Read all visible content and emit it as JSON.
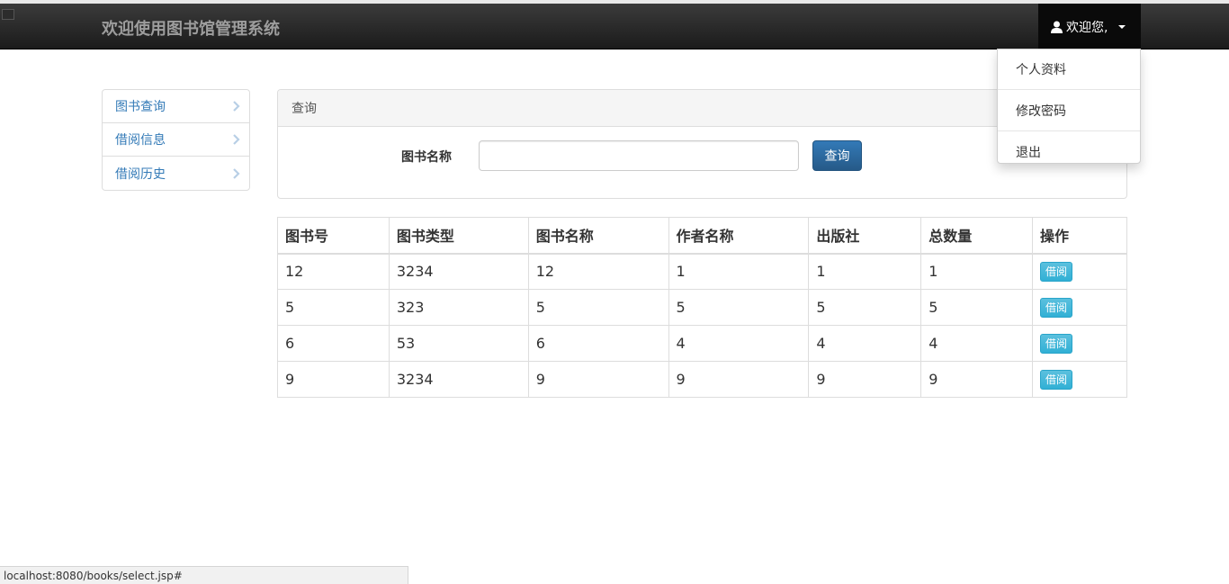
{
  "navbar": {
    "brand": "欢迎使用图书馆管理系统",
    "user_label": "欢迎您,",
    "icons": {
      "user": "user-icon",
      "caret": "caret-down-icon"
    }
  },
  "dropdown": {
    "items": [
      "个人资料",
      "修改密码",
      "退出"
    ]
  },
  "sidebar": {
    "items": [
      {
        "label": "图书查询",
        "icon": "chevron-right-icon"
      },
      {
        "label": "借阅信息",
        "icon": "chevron-right-icon"
      },
      {
        "label": "借阅历史",
        "icon": "chevron-right-icon"
      }
    ]
  },
  "query_panel": {
    "heading": "查询",
    "field_label": "图书名称",
    "input_value": "",
    "button_label": "查询"
  },
  "table": {
    "headers": [
      "图书号",
      "图书类型",
      "图书名称",
      "作者名称",
      "出版社",
      "总数量",
      "操作"
    ],
    "rows": [
      {
        "id": "12",
        "type": "3234",
        "name": "12",
        "author": "1",
        "publisher": "1",
        "total": "1",
        "action": "借阅"
      },
      {
        "id": "5",
        "type": "323",
        "name": "5",
        "author": "5",
        "publisher": "5",
        "total": "5",
        "action": "借阅"
      },
      {
        "id": "6",
        "type": "53",
        "name": "6",
        "author": "4",
        "publisher": "4",
        "total": "4",
        "action": "借阅"
      },
      {
        "id": "9",
        "type": "3234",
        "name": "9",
        "author": "9",
        "publisher": "9",
        "total": "9",
        "action": "借阅"
      }
    ]
  },
  "statusbar": {
    "url": "localhost:8080/books/select.jsp#"
  },
  "colors": {
    "navbar_bg": "#222222",
    "link": "#337ab7",
    "primary_btn": "#286090",
    "info_btn": "#5bc0de"
  }
}
